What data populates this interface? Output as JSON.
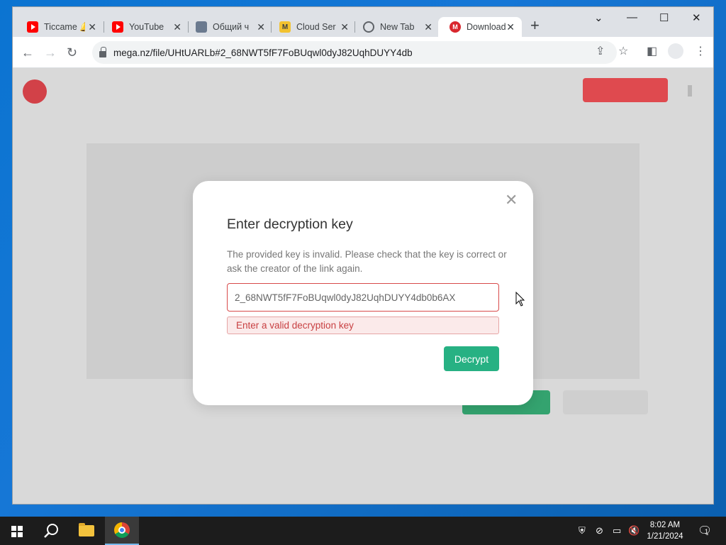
{
  "browser": {
    "tabs": [
      {
        "title": "Ticcame 🔔",
        "icon": "youtube-icon",
        "active": false
      },
      {
        "title": "YouTube",
        "icon": "youtube-icon",
        "active": false
      },
      {
        "title": "Общий ч",
        "icon": "forum-icon",
        "active": false
      },
      {
        "title": "Cloud Ser",
        "icon": "mega-m-icon",
        "active": false
      },
      {
        "title": "New Tab",
        "icon": "chrome-icon",
        "active": false
      },
      {
        "title": "Download",
        "icon": "mega-icon",
        "active": true
      }
    ],
    "address_bar": {
      "url": "mega.nz/file/UHtUARLb#2_68NWT5fF7FoBUqwl0dyJ82UqhDUYY4db"
    }
  },
  "modal": {
    "title": "Enter decryption key",
    "description": "The provided key is invalid. Please check that the key is correct or ask the creator of the link again.",
    "key_value": "2_68NWT5fF7FoBUqwl0dyJ82UqhDUYY4db0b6AX",
    "error_message": "Enter a valid decryption key",
    "decrypt_label": "Decrypt",
    "close_glyph": "✕"
  },
  "taskbar": {
    "time": "8:02 AM",
    "date": "1/21/2024",
    "notification_count": "1"
  },
  "colors": {
    "accent_green": "#27b183",
    "error_red": "#d84a4a",
    "mega_red": "#d9272e"
  }
}
